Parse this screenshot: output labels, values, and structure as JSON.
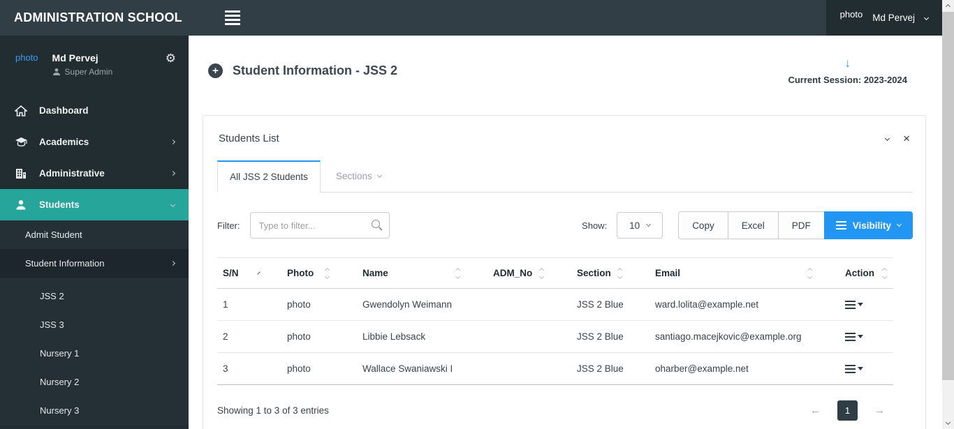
{
  "topbar": {
    "brand": "ADMINISTRATION SCHOOL",
    "user": {
      "photo_label": "photo",
      "name": "Md Pervej"
    }
  },
  "sidebar": {
    "profile": {
      "photo_label": "photo",
      "name": "Md Pervej",
      "role": "Super Admin",
      "gear_icon": "⚙"
    },
    "items": [
      {
        "label": "Dashboard"
      },
      {
        "label": "Academics"
      },
      {
        "label": "Administrative"
      },
      {
        "label": "Students"
      }
    ],
    "students_submenu": [
      {
        "label": "Admit Student"
      },
      {
        "label": "Student Information"
      }
    ],
    "class_links": [
      {
        "label": "JSS 2"
      },
      {
        "label": "JSS 3"
      },
      {
        "label": "Nursery 1"
      },
      {
        "label": "Nursery 2"
      },
      {
        "label": "Nursery 3"
      }
    ]
  },
  "header": {
    "title": "Student Information - JSS 2",
    "session_arrow": "↓",
    "session_label": "Current Session: 2023-2024"
  },
  "card": {
    "title": "Students List",
    "close_icon": "×",
    "tabs": [
      {
        "label": "All JSS 2 Students"
      },
      {
        "label": "Sections"
      }
    ],
    "filter": {
      "label": "Filter:",
      "placeholder": "Type to filter...",
      "value": ""
    },
    "show": {
      "label": "Show:",
      "selected": "10"
    },
    "export_buttons": [
      "Copy",
      "Excel",
      "PDF"
    ],
    "visibility_button": "Visibility",
    "table": {
      "columns": [
        "S/N",
        "Photo",
        "Name",
        "ADM_No",
        "Section",
        "Email",
        "Action"
      ],
      "rows": [
        {
          "sn": "1",
          "photo": "photo",
          "name": "Gwendolyn Weimann",
          "adm_no": "",
          "section": "JSS 2 Blue",
          "email": "ward.lolita@example.net"
        },
        {
          "sn": "2",
          "photo": "photo",
          "name": "Libbie Lebsack",
          "adm_no": "",
          "section": "JSS 2 Blue",
          "email": "santiago.macejkovic@example.org"
        },
        {
          "sn": "3",
          "photo": "photo",
          "name": "Wallace Swaniawski I",
          "adm_no": "",
          "section": "JSS 2 Blue",
          "email": "oharber@example.net"
        }
      ]
    },
    "footer": {
      "showing": "Showing 1 to 3 of 3 entries",
      "page": "1",
      "prev_icon": "←",
      "next_icon": "→"
    }
  },
  "colors": {
    "accent_blue": "#2196f3",
    "teal_active": "#26a69a",
    "navbar": "#323e45",
    "sidebar": "#222d32"
  }
}
